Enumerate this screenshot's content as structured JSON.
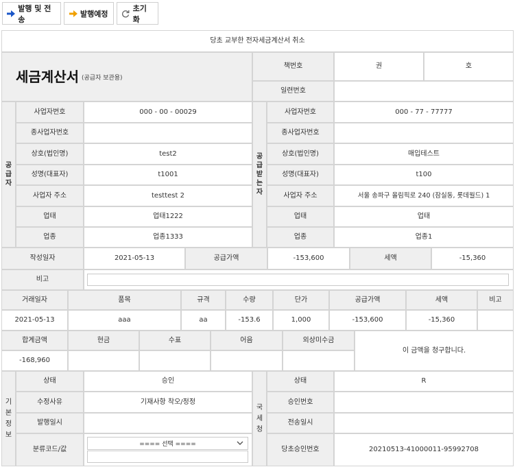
{
  "toolbar": {
    "issue_send": "발행 및 전송",
    "issue_schedule": "발행예정",
    "reset": "초기화"
  },
  "notice": "당초 교부한 전자세금계산서 취소",
  "title": {
    "main": "세금계산서",
    "sub": "(공급자 보관용)"
  },
  "book": {
    "label": "책번호",
    "volume": "권",
    "number": "호",
    "serial_label": "일련번호",
    "serial_value": ""
  },
  "supplier": {
    "section": "공급자",
    "reg_no_label": "사업자번호",
    "reg_no": "000 - 00 - 00029",
    "sub_reg_label": "종사업자번호",
    "sub_reg": "",
    "company_label": "상호(법인명)",
    "company": "test2",
    "ceo_label": "성명(대표자)",
    "ceo": "t1001",
    "address_label": "사업자 주소",
    "address": "testtest 2",
    "biz_type_label": "업태",
    "biz_type": "업태1222",
    "biz_item_label": "업종",
    "biz_item": "업종1333"
  },
  "buyer": {
    "section": "공급받는자",
    "reg_no_label": "사업자번호",
    "reg_no": "000 - 77 - 77777",
    "sub_reg_label": "종사업자번호",
    "sub_reg": "",
    "company_label": "상호(법인명)",
    "company": "매입테스트",
    "ceo_label": "성명(대표자)",
    "ceo": "t100",
    "address_label": "사업자 주소",
    "address": "서울 송파구 올림픽로 240 (잠실동, 롯데월드) 1",
    "biz_type_label": "업태",
    "biz_type": "업태",
    "biz_item_label": "업종",
    "biz_item": "업종1"
  },
  "summary": {
    "date_label": "작성일자",
    "date": "2021-05-13",
    "supply_label": "공급가액",
    "supply": "-153,600",
    "tax_label": "세액",
    "tax": "-15,360",
    "memo_label": "비고"
  },
  "items": {
    "headers": [
      "거래일자",
      "품목",
      "규격",
      "수량",
      "단가",
      "공급가액",
      "세액",
      "비고"
    ],
    "rows": [
      [
        "2021-05-13",
        "aaa",
        "aa",
        "-153.6",
        "1,000",
        "-153,600",
        "-15,360",
        ""
      ]
    ]
  },
  "totals": {
    "headers": [
      "합계금액",
      "현금",
      "수표",
      "어음",
      "외상미수금"
    ],
    "values": [
      "-168,960",
      "",
      "",
      "",
      ""
    ],
    "claim_text": "이 금액을 청구합니다."
  },
  "basic_info": {
    "section": "기본정보",
    "status_label": "상태",
    "status": "승인",
    "reason_label": "수정사유",
    "reason": "기재사항 착오/정정",
    "issued_label": "발행일시",
    "issued": "",
    "category_label": "분류코드/값",
    "category_select": "==== 선택 ===="
  },
  "nts": {
    "section": "국세청",
    "status_label": "상태",
    "status": "R",
    "approval_label": "승인번호",
    "approval": "",
    "sent_label": "전송일시",
    "sent": "",
    "original_label": "당초승인번호",
    "original": "20210513-41000011-95992708"
  },
  "colors": {
    "header_bg": "#efefef",
    "border": "#d4d4d4",
    "arrow_blue": "#1a56c8",
    "arrow_orange": "#f0a000"
  }
}
